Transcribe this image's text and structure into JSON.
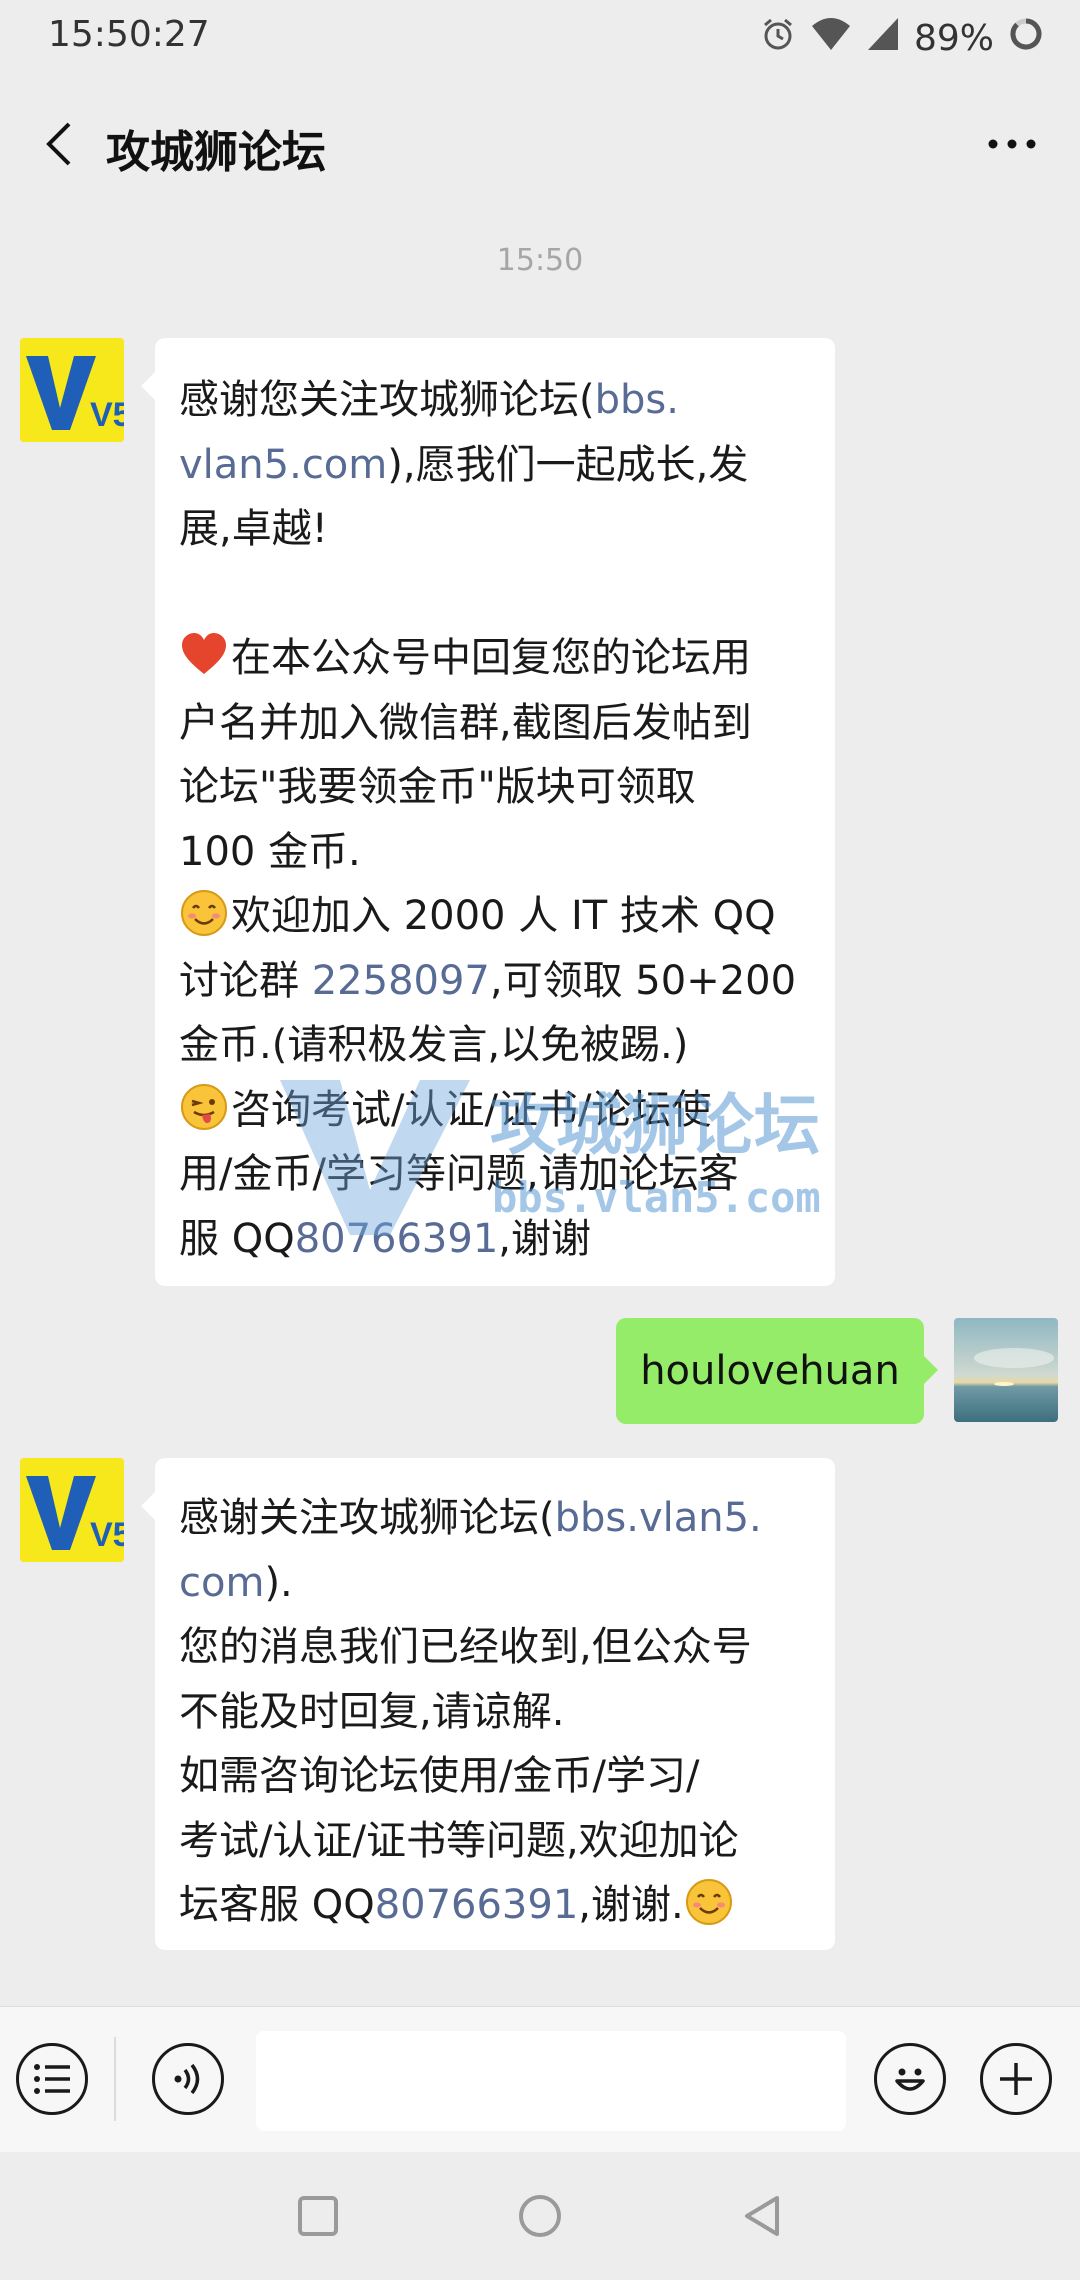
{
  "status_bar": {
    "time": "15:50:27",
    "battery_percent": "89%",
    "icons": [
      "alarm-icon",
      "wifi-icon",
      "signal-icon",
      "battery-icon"
    ]
  },
  "header": {
    "title": "攻城狮论坛",
    "back_icon": "chevron-left-icon",
    "more_icon": "more-dots-icon"
  },
  "chat": {
    "timestamp": "15:50",
    "messages": [
      {
        "sender": "official-account",
        "lines": [
          [
            {
              "t": "感谢您关注攻城狮论坛("
            },
            {
              "t": "bbs.",
              "link": true
            }
          ],
          [
            {
              "t": "vlan5.com",
              "link": true
            },
            {
              "t": "),愿我们一起成长,发"
            }
          ],
          [
            {
              "t": "展,卓越!"
            }
          ],
          [
            {
              "t": ""
            }
          ],
          [
            {
              "emoji": "heart-emoji"
            },
            {
              "t": "在本公众号中回复您的论坛用"
            }
          ],
          [
            {
              "t": "户名并加入微信群,截图后发帖到"
            }
          ],
          [
            {
              "t": "论坛\"我要领金币\"版块可领取"
            }
          ],
          [
            {
              "t": "100 金币."
            }
          ],
          [
            {
              "emoji": "smile-emoji"
            },
            {
              "t": "欢迎加入 2000 人 IT 技术 QQ"
            }
          ],
          [
            {
              "t": "讨论群 "
            },
            {
              "t": "2258097",
              "link": true
            },
            {
              "t": ",可领取 50+200"
            }
          ],
          [
            {
              "t": "金币.(请积极发言,以免被踢.)"
            }
          ],
          [
            {
              "emoji": "wink-tongue-emoji"
            },
            {
              "t": "咨询考试/认证/证书/论坛使"
            }
          ],
          [
            {
              "t": "用/金币/学习等问题,请加论坛客"
            }
          ],
          [
            {
              "t": "服 QQ"
            },
            {
              "t": "80766391",
              "link": true
            },
            {
              "t": ",谢谢"
            }
          ]
        ]
      },
      {
        "sender": "me",
        "text": "houlovehuan"
      },
      {
        "sender": "official-account",
        "lines": [
          [
            {
              "t": "感谢关注攻城狮论坛("
            },
            {
              "t": "bbs.vlan5.",
              "link": true
            }
          ],
          [
            {
              "t": "com",
              "link": true
            },
            {
              "t": ")."
            }
          ],
          [
            {
              "t": "您的消息我们已经收到,但公众号"
            }
          ],
          [
            {
              "t": "不能及时回复,请谅解."
            }
          ],
          [
            {
              "t": "如需咨询论坛使用/金币/学习/"
            }
          ],
          [
            {
              "t": "考试/认证/证书等问题,欢迎加论"
            }
          ],
          [
            {
              "t": "坛客服 QQ"
            },
            {
              "t": "80766391",
              "link": true
            },
            {
              "t": ",谢谢."
            },
            {
              "emoji": "smile-emoji"
            }
          ]
        ]
      }
    ]
  },
  "watermark": {
    "title": "攻城狮论坛",
    "url": "bbs.vlan5.com"
  },
  "avatar_text": "V5",
  "input_bar": {
    "value": "",
    "placeholder": "",
    "menu_icon": "list-menu-icon",
    "voice_icon": "voice-icon",
    "emoji_icon": "emoji-icon",
    "plus_icon": "plus-icon"
  },
  "nav_bar": {
    "icons": [
      "square-recents-icon",
      "circle-home-icon",
      "triangle-back-icon"
    ]
  },
  "colors": {
    "background": "#ededed",
    "bubble_received": "#ffffff",
    "bubble_sent": "#95ec69",
    "link": "#576b95",
    "avatar_yellow": "#f7e81c",
    "avatar_blue": "#1f5fb7"
  }
}
